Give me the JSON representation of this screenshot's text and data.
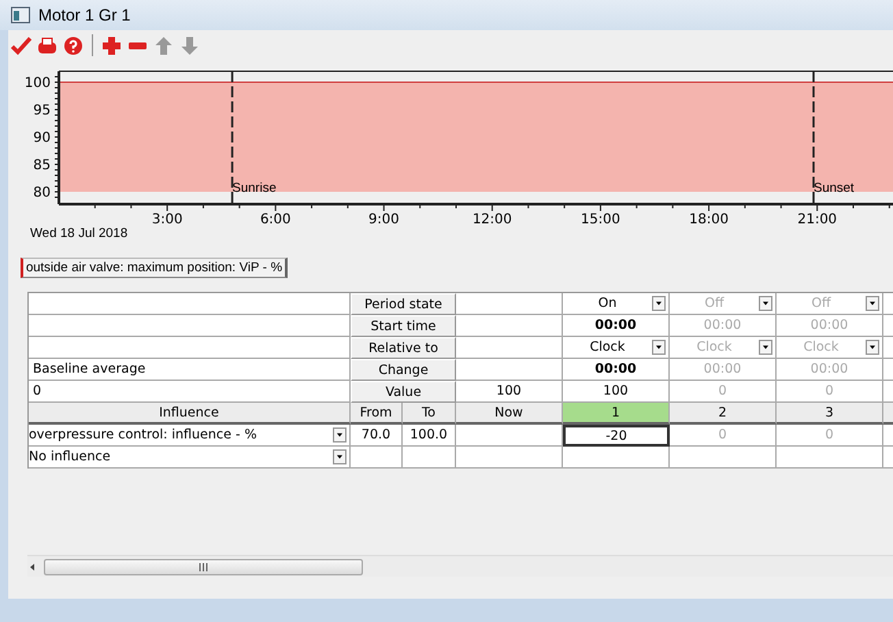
{
  "window": {
    "title": "Motor 1 Gr 1"
  },
  "toolbar": [
    {
      "kind": "check",
      "disabled": false
    },
    {
      "kind": "print",
      "disabled": false
    },
    {
      "kind": "help",
      "disabled": false
    },
    {
      "kind": "separator"
    },
    {
      "kind": "add",
      "disabled": false
    },
    {
      "kind": "remove",
      "disabled": false
    },
    {
      "kind": "up",
      "disabled": true
    },
    {
      "kind": "down",
      "disabled": true
    }
  ],
  "chart": {
    "date": "Wed 18 Jul 2018",
    "chart_data": {
      "type": "area",
      "x": [
        0,
        23.1
      ],
      "xlim": [
        0,
        23.1
      ],
      "ylim": [
        78,
        102
      ],
      "xticks": [
        {
          "value": 3,
          "label": "3:00"
        },
        {
          "value": 6,
          "label": "6:00"
        },
        {
          "value": 9,
          "label": "9:00"
        },
        {
          "value": 12,
          "label": "12:00"
        },
        {
          "value": 15,
          "label": "15:00"
        },
        {
          "value": 18,
          "label": "18:00"
        },
        {
          "value": 21,
          "label": "21:00"
        }
      ],
      "yticks": [
        80,
        85,
        90,
        95,
        100
      ],
      "series": [
        {
          "name": "outside air valve: maximum position: ViP - %",
          "color": "#f4b4ae",
          "values": [
            100,
            100
          ]
        }
      ],
      "ref_lines": [
        {
          "axis": "x",
          "value": 4.8
        },
        {
          "axis": "x",
          "value": 20.9
        }
      ],
      "annotations": [
        {
          "x": 4.8,
          "y": 80,
          "text": "Sunrise"
        },
        {
          "x": 20.9,
          "y": 80,
          "text": "Sunset"
        }
      ]
    }
  },
  "legend_tab": {
    "selected": true
  },
  "schedule": {
    "row_labels": [
      "Period state",
      "Start time",
      "Relative to",
      "Change",
      "Value"
    ],
    "left_cells": [
      "Baseline average",
      "0"
    ],
    "now_value": "100",
    "influence_header": {
      "name": "Influence",
      "from": "From",
      "to": "To",
      "now": "Now"
    },
    "periods": [
      {
        "label": "1",
        "selected": true,
        "disabled": false,
        "state": "On",
        "start_time": "00:00",
        "relative_to": "Clock",
        "change": "00:00",
        "value": "100"
      },
      {
        "label": "2",
        "selected": false,
        "disabled": true,
        "state": "Off",
        "start_time": "00:00",
        "relative_to": "Clock",
        "change": "00:00",
        "value": "0"
      },
      {
        "label": "3",
        "selected": false,
        "disabled": true,
        "state": "Off",
        "start_time": "00:00",
        "relative_to": "Clock",
        "change": "00:00",
        "value": "0"
      }
    ],
    "influences": [
      {
        "name": "overpressure control: influence - %",
        "from": "70.0",
        "to": "100.0",
        "values": [
          "-20",
          "0",
          "0"
        ]
      },
      {
        "name": "No influence"
      }
    ]
  }
}
